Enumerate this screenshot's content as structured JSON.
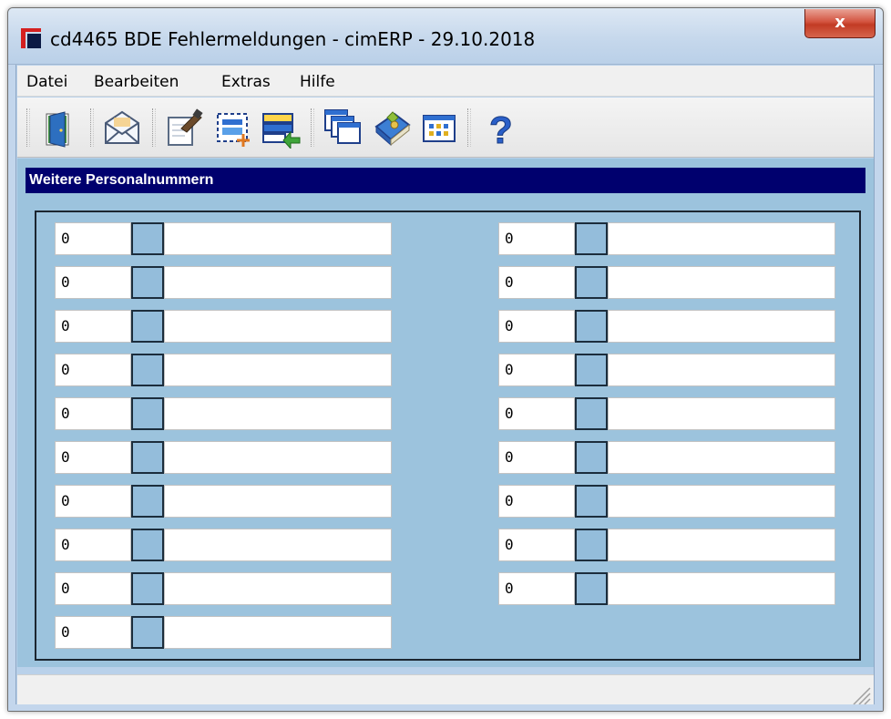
{
  "window": {
    "title": "cd4465 BDE Fehlermeldungen - cimERP - 29.10.2018",
    "close_label": "x"
  },
  "menu": [
    "Datei",
    "Bearbeiten",
    "Extras",
    "Hilfe"
  ],
  "toolbar": {
    "icons": [
      "exit-door-icon",
      "envelope-icon",
      "edit-document-icon",
      "new-record-icon",
      "import-list-icon",
      "windows-icon",
      "book-icon",
      "grid-icon",
      "help-icon"
    ]
  },
  "section": {
    "title": "Weitere Personalnummern"
  },
  "left_column": [
    "0",
    "0",
    "0",
    "0",
    "0",
    "0",
    "0",
    "0",
    "0",
    "0"
  ],
  "right_column": [
    "0",
    "0",
    "0",
    "0",
    "0",
    "0",
    "0",
    "0",
    "0"
  ],
  "colors": {
    "header_bg": "#00006e",
    "content_bg": "#9cc3dd",
    "button_bg": "#94bddb"
  }
}
